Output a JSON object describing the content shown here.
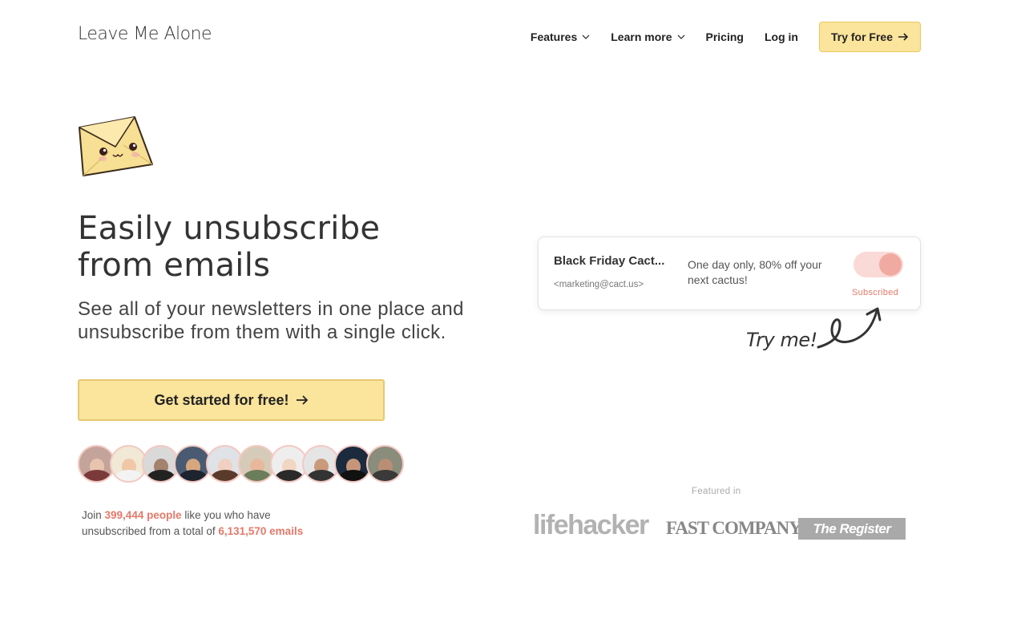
{
  "header": {
    "logo": "Leave Me Alone",
    "nav": {
      "features": "Features",
      "learn_more": "Learn more",
      "pricing": "Pricing",
      "login": "Log in",
      "cta": "Try for Free"
    }
  },
  "hero": {
    "headline_line1": "Easily unsubscribe",
    "headline_line2": "from emails",
    "subhead_line1": "See all of your newsletters in one place and",
    "subhead_line2": "unsubscribe from them with a single click.",
    "cta": "Get started for free!"
  },
  "social_proof": {
    "join_prefix": "Join",
    "people_count": "399,444 people",
    "join_middle": "like you who have",
    "line2_prefix": "unsubscribed from a total of",
    "emails_count": "6,131,570 emails"
  },
  "demo_card": {
    "from": "Black Friday Cact...",
    "email": "<marketing@cact.us>",
    "snippet": "One day only, 80% off your next cactus!",
    "status": "Subscribed",
    "toggle_on": true
  },
  "try_me": "Try me!",
  "featured": {
    "label": "Featured in",
    "logos": [
      "lifehacker",
      "FAST COMPANY",
      "The Register"
    ]
  },
  "colors": {
    "accent_yellow": "#fbe49b",
    "accent_pink": "#e4796a",
    "toggle_bg": "#f9dad6"
  }
}
